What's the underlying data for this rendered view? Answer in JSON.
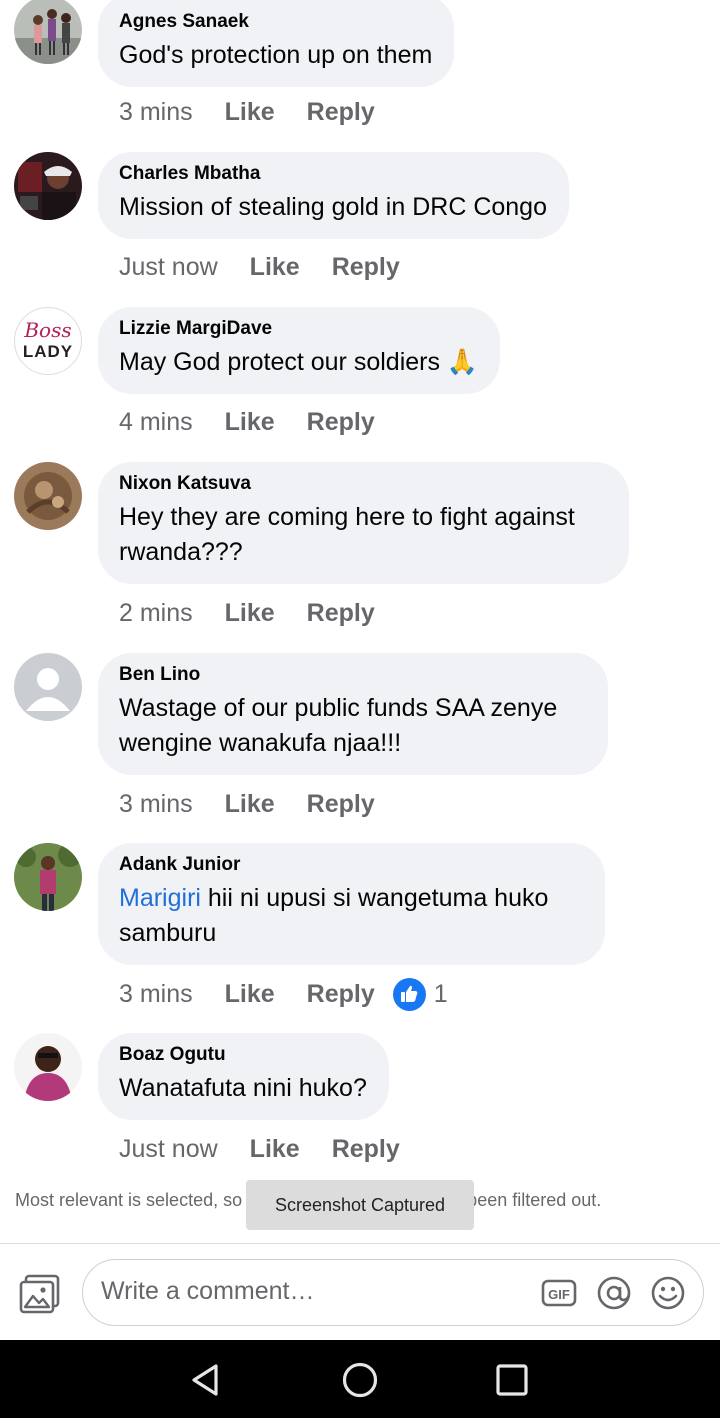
{
  "comments": [
    {
      "author": "Agnes Sanaek",
      "text": "God's protection up on them",
      "time": "3 mins",
      "like": "Like",
      "reply": "Reply"
    },
    {
      "author": "Charles Mbatha",
      "text": "Mission of stealing gold in DRC Congo",
      "time": "Just now",
      "like": "Like",
      "reply": "Reply"
    },
    {
      "author": "Lizzie MargiDave",
      "text": "May God protect our soldiers 🙏",
      "time": "4 mins",
      "like": "Like",
      "reply": "Reply",
      "avatar_text_1": "Boss",
      "avatar_text_2": "LADY"
    },
    {
      "author": "Nixon Katsuva",
      "text": "Hey they are coming here to fight against rwanda???",
      "time": "2 mins",
      "like": "Like",
      "reply": "Reply"
    },
    {
      "author": "Ben Lino",
      "text": "Wastage of our public funds SAA zenye wengine wanakufa njaa!!!",
      "time": "3 mins",
      "like": "Like",
      "reply": "Reply"
    },
    {
      "author": "Adank Junior",
      "mention": "Marigiri",
      "text": " hii ni upusi si wangetuma huko samburu",
      "time": "3 mins",
      "like": "Like",
      "reply": "Reply",
      "reaction_count": "1"
    },
    {
      "author": "Boaz Ogutu",
      "text": "Wanatafuta nini huko?",
      "time": "Just now",
      "like": "Like",
      "reply": "Reply"
    }
  ],
  "filter_note": "Most relevant is selected, so some comments may have been filtered out.",
  "toast": "Screenshot Captured",
  "composer": {
    "placeholder": "Write a comment…",
    "gif_label": "GIF",
    "icons": [
      "photo-icon",
      "gif-icon",
      "mention-icon",
      "emoji-icon"
    ]
  },
  "colors": {
    "bubble": "#f0f2f5",
    "mention": "#216fdb",
    "like_badge": "#1877f2",
    "meta": "#65676b"
  },
  "system_nav": [
    "back-icon",
    "home-icon",
    "recents-icon"
  ]
}
